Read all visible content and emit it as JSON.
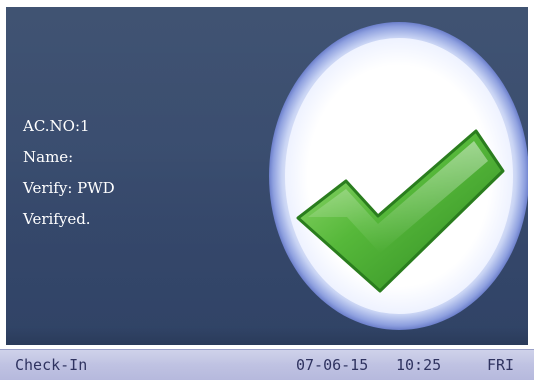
{
  "user_info": {
    "ac_no": "AC.NO:1",
    "name": "Name:",
    "verify": "Verify: PWD",
    "result": "Verifyed."
  },
  "status_bar": {
    "mode": "Check-In",
    "date": "07-06-15",
    "time": "10:25",
    "day": "FRI"
  },
  "indicator": {
    "icon": "checkmark-icon",
    "check_color": "#3f9b2a",
    "circle_color": "#ffffff"
  }
}
